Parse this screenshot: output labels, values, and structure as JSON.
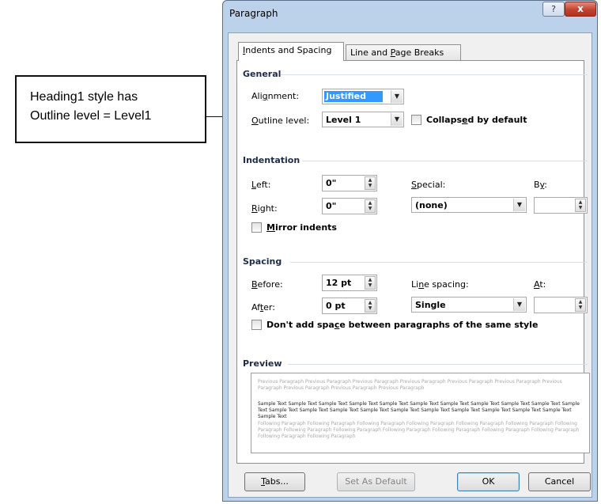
{
  "callout": {
    "line1": "Heading1 style has",
    "line2": "Outline level = Level1"
  },
  "window": {
    "title": "Paragraph",
    "help_label": "?",
    "close_label": "x"
  },
  "tabs": [
    {
      "label": "Indents and Spacing",
      "underline": "I",
      "rest": "ndents and Spacing",
      "active": true
    },
    {
      "label": "Line and Page Breaks",
      "pre": "Line and ",
      "underline": "P",
      "rest": "age Breaks",
      "active": false
    }
  ],
  "general": {
    "title": "General",
    "alignment_label_pre": "Ali",
    "alignment_label_u": "g",
    "alignment_label_post": "nment:",
    "alignment_value": "Justified",
    "outline_label_u": "O",
    "outline_label_post": "utline level:",
    "outline_value": "Level 1",
    "collapsed_pre": "Collaps",
    "collapsed_u": "e",
    "collapsed_post": "d by default",
    "collapsed_checked": false
  },
  "indentation": {
    "title": "Indentation",
    "left_u": "L",
    "left_post": "eft:",
    "left_value": "0\"",
    "right_u": "R",
    "right_post": "ight:",
    "right_value": "0\"",
    "special_u": "S",
    "special_post": "pecial:",
    "special_value": "(none)",
    "by_pre": "B",
    "by_u": "y",
    "by_post": ":",
    "by_value": "",
    "mirror_u": "M",
    "mirror_post": "irror indents",
    "mirror_checked": false
  },
  "spacing": {
    "title": "Spacing",
    "before_u": "B",
    "before_post": "efore:",
    "before_value": "12 pt",
    "after_pre": "Af",
    "after_u": "t",
    "after_post": "er:",
    "after_value": "0 pt",
    "line_pre": "Li",
    "line_u": "n",
    "line_post": "e spacing:",
    "line_value": "Single",
    "at_u": "A",
    "at_post": "t:",
    "at_value": "",
    "dont_add_pre": "Don't add spa",
    "dont_add_u": "c",
    "dont_add_post": "e between paragraphs of the same style",
    "dont_add_checked": false
  },
  "preview": {
    "title": "Preview",
    "previous_text": "Previous Paragraph Previous Paragraph Previous Paragraph Previous Paragraph Previous Paragraph Previous Paragraph Previous Paragraph Previous Paragraph Previous Paragraph Previous Paragraph",
    "sample_text": "Sample Text Sample Text Sample Text Sample Text Sample Text Sample Text Sample Text Sample Text Sample Text Sample Text Sample Text Sample Text Sample Text Sample Text Sample Text Sample Text Sample Text Sample Text Sample Text Sample Text Sample Text Sample Text",
    "following_text": "Following Paragraph Following Paragraph Following Paragraph Following Paragraph Following Paragraph Following Paragraph Following Paragraph Following Paragraph Following Paragraph Following Paragraph Following Paragraph Following Paragraph Following Paragraph Following Paragraph Following Paragraph"
  },
  "buttons": {
    "tabs_u": "T",
    "tabs_post": "abs...",
    "set_default": "Set As Default",
    "ok": "OK",
    "cancel": "Cancel"
  },
  "colors": {
    "window_frame": "#bcd1ea",
    "selection": "#3399ff",
    "close_button": "#c3422f",
    "section_title": "#1e2b48"
  }
}
